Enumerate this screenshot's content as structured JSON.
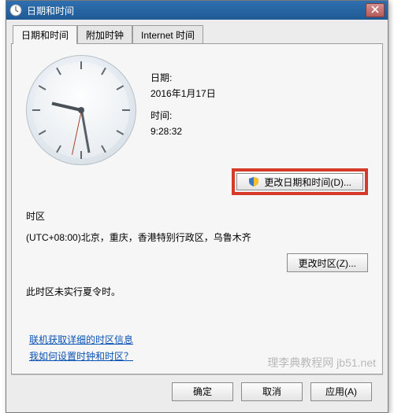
{
  "window": {
    "title": "日期和时间"
  },
  "tabs": [
    {
      "label": "日期和时间"
    },
    {
      "label": "附加时钟"
    },
    {
      "label": "Internet 时间"
    }
  ],
  "datetime": {
    "date_label": "日期:",
    "date_value": "2016年1月17日",
    "time_label": "时间:",
    "time_value": "9:28:32",
    "change_button": "更改日期和时间(D)..."
  },
  "timezone": {
    "section_label": "时区",
    "value": "(UTC+08:00)北京，重庆，香港特别行政区，乌鲁木齐",
    "change_button": "更改时区(Z)...",
    "dst_note": "此时区未实行夏令时。"
  },
  "links": {
    "tz_details": "联机获取详细的时区信息",
    "how_to": "我如何设置时钟和时区？"
  },
  "footer": {
    "ok": "确定",
    "cancel": "取消",
    "apply": "应用(A)"
  },
  "watermark": "理李典教程网 jb51.net"
}
